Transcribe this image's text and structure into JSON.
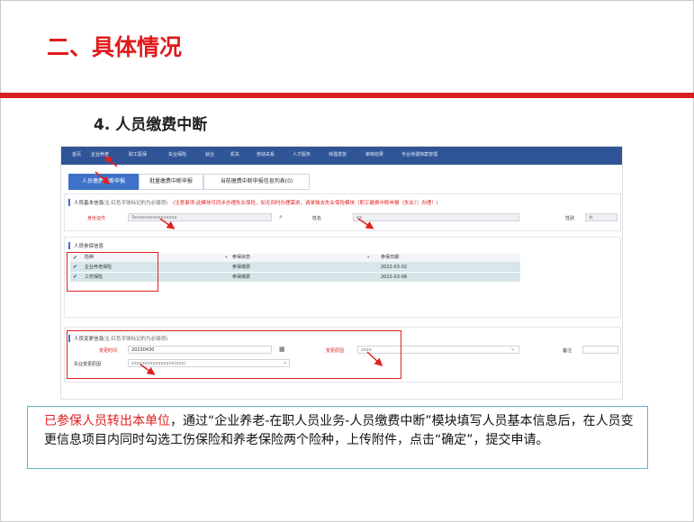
{
  "slide": {
    "title": "二、具体情况",
    "subtitle": "4. 人员缴费中断"
  },
  "screenshot": {
    "nav": [
      "首页",
      "企业养老",
      "职工医保",
      "失业保险",
      "就业",
      "机关",
      "劳动关系",
      "人才服务",
      "待遇发放",
      "审核结果",
      "专业待遇档案管理"
    ],
    "tabs": [
      "人员缴费中断申报",
      "批量缴费中断申报",
      "当前缴费中断申报信息列表(0)"
    ],
    "basic_section": {
      "title": "人员基本信息",
      "hint": "(注:红色字体标记的为必填项)",
      "warning": "(注意事项:此模块可同步办理失业保险，如无同时办理需求，请单独去失业保险模块（职工缴费中断申报（失业））办理！)",
      "id_label": "身份证件",
      "id_value": "3xxxxxxxxxxxxxxxx",
      "name_label": "姓名",
      "name_value": "xx",
      "gender_label": "性别",
      "gender_value": "女"
    },
    "insurance_section": {
      "title": "人员参保信息",
      "columns": [
        "险种",
        "参保状态",
        "参保日期"
      ],
      "rows": [
        {
          "type": "企业养老保险",
          "status": "参保缴费",
          "date": "2022-03-02"
        },
        {
          "type": "工伤保险",
          "status": "参保缴费",
          "date": "2022-03-08"
        }
      ]
    },
    "change_section": {
      "title": "人员变更信息",
      "hint": "(注:红色字体标记的为必填项)",
      "time_label": "变更时间",
      "time_value": "20230430",
      "reason_label": "变更原因",
      "reason_value": "xxxx",
      "note_label": "备注",
      "unemployment_label": "失业变更原因",
      "unemployment_value": "xxxxxxxxxxxxxxxx(xxx)"
    }
  },
  "description": {
    "highlight": "已参保人员转出本单位",
    "text": "，通过“企业养老-在职人员业务-人员缴费中断”模块填写人员基本信息后，在人员变更信息项目内同时勾选工伤保险和养老保险两个险种，上传附件，点击“确定”，提交申请。"
  },
  "colors": {
    "title_red": "#e01b1b",
    "nav_blue": "#2f5597",
    "highlight_red": "#e02020",
    "row_teal": "#d6e6e9",
    "textbox_border": "#5eb3c8"
  }
}
